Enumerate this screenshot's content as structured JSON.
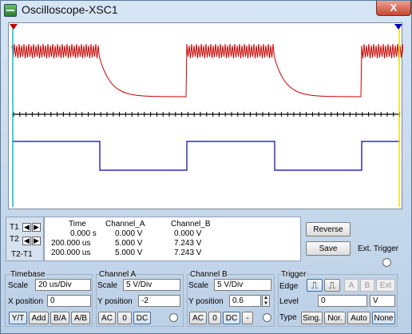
{
  "window": {
    "title": "Oscilloscope-XSC1",
    "close_label": "X"
  },
  "screen": {
    "background": "#ffffff",
    "cursor_t1_color": "#00c8c8",
    "cursor_t2_color": "#e8e000",
    "channel_a_color": "#c80000",
    "channel_b_color": "#0000b4",
    "axis_color": "#000000"
  },
  "readout": {
    "headers": [
      "Time",
      "Channel_A",
      "Channel_B"
    ],
    "rows": [
      {
        "label": "T1",
        "time": "0.000 s",
        "channel_a": "0.000 V",
        "channel_b": "0.000 V"
      },
      {
        "label": "T2",
        "time": "200.000 us",
        "channel_a": "5.000 V",
        "channel_b": "7.243 V"
      },
      {
        "label": "T2-T1",
        "time": "200.000 us",
        "channel_a": "5.000 V",
        "channel_b": "7.243 V"
      }
    ]
  },
  "buttons": {
    "reverse": "Reverse",
    "save": "Save",
    "ext_trigger": "Ext. Trigger"
  },
  "timebase": {
    "title": "Timebase",
    "scale_label": "Scale",
    "scale_value": "20 us/Div",
    "xpos_label": "X position",
    "xpos_value": "0",
    "modes": [
      "Y/T",
      "Add",
      "B/A",
      "A/B"
    ]
  },
  "channel_a": {
    "title": "Channel A",
    "scale_label": "Scale",
    "scale_value": "5  V/Div",
    "ypos_label": "Y position",
    "ypos_value": "-2",
    "coupling": [
      "AC",
      "0",
      "DC"
    ]
  },
  "channel_b": {
    "title": "Channel B",
    "scale_label": "Scale",
    "scale_value": "5  V/Div",
    "ypos_label": "Y position",
    "ypos_value": "0.6",
    "coupling": [
      "AC",
      "0",
      "DC",
      "-"
    ]
  },
  "trigger": {
    "title": "Trigger",
    "edge_label": "Edge",
    "sources": [
      "A",
      "B",
      "Ext"
    ],
    "level_label": "Level",
    "level_value": "0",
    "level_unit": "V",
    "type_label": "Type",
    "types": [
      "Sing.",
      "Nor.",
      "Auto",
      "None"
    ]
  }
}
